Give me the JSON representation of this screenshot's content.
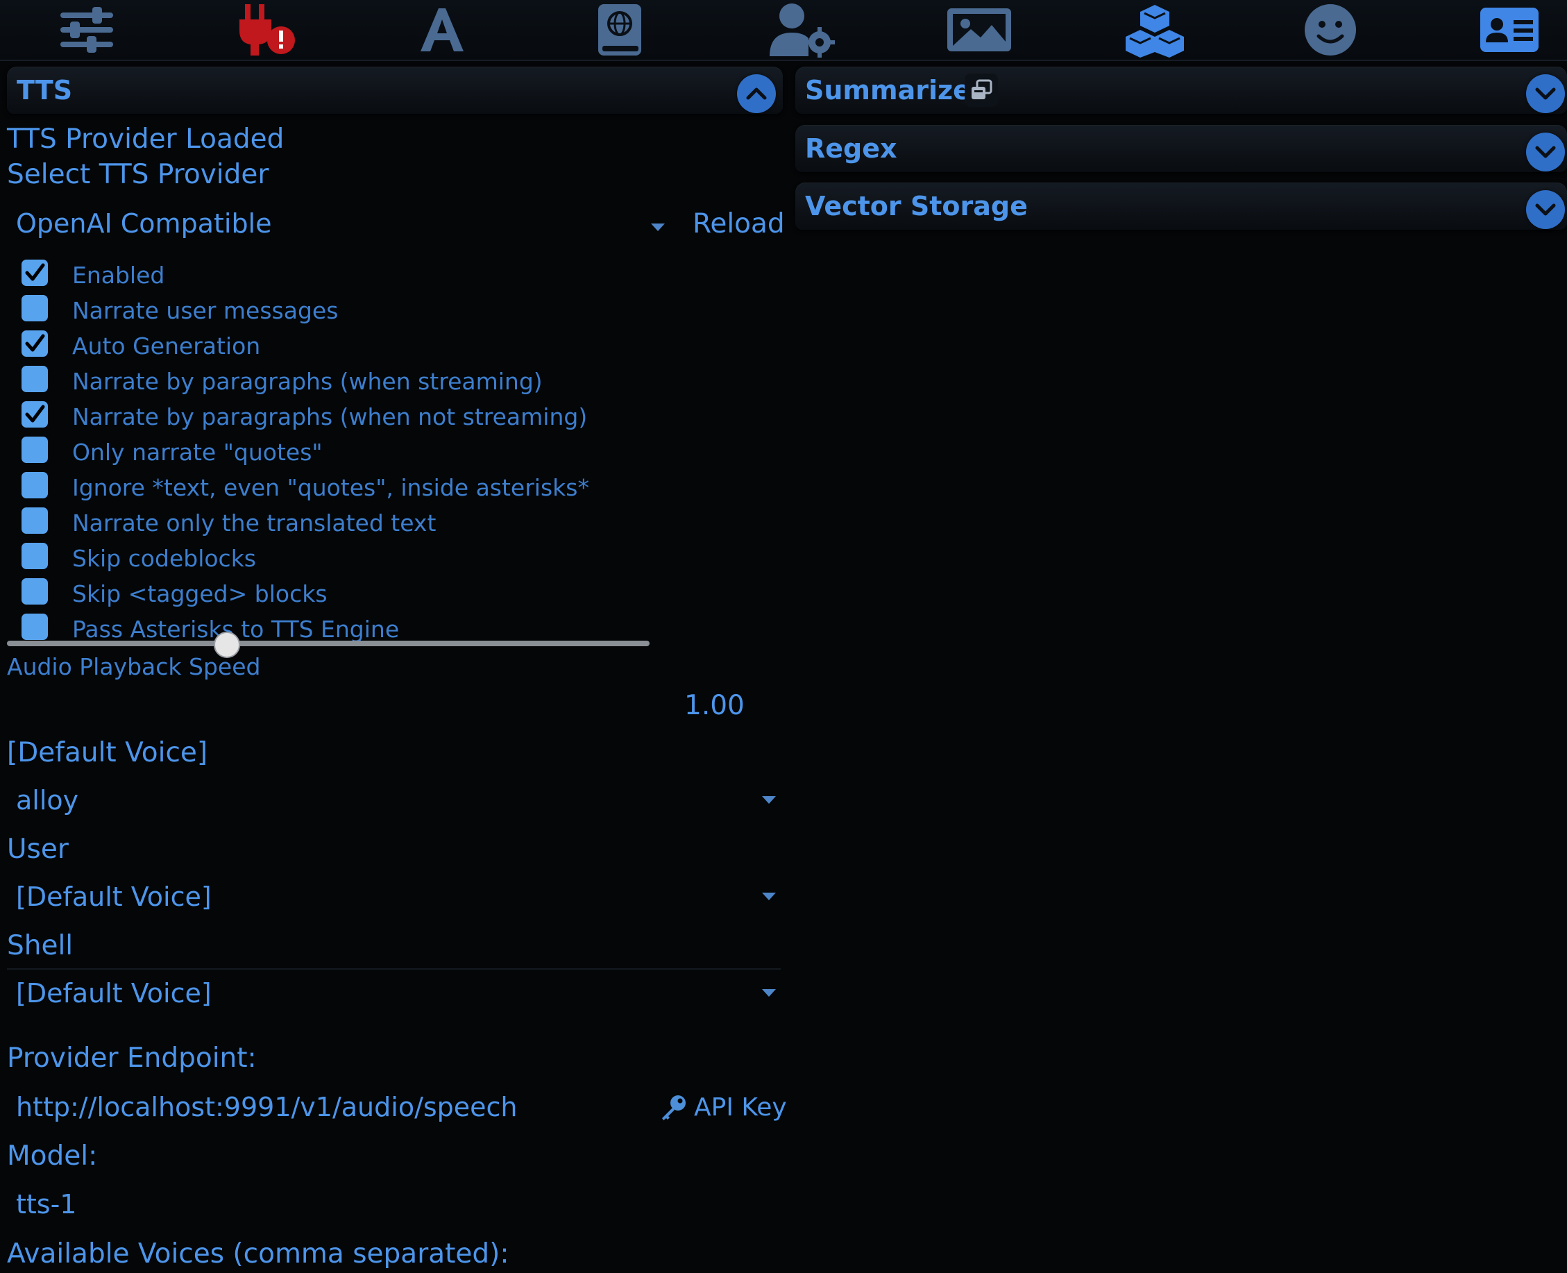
{
  "topbar": {
    "icons": [
      {
        "name": "sliders-icon",
        "color": "#4a6a92"
      },
      {
        "name": "plug-alert-icon",
        "color": "#c0181c"
      },
      {
        "name": "font-icon",
        "color": "#4a6a92"
      },
      {
        "name": "world-book-icon",
        "color": "#4a6a92"
      },
      {
        "name": "user-gear-icon",
        "color": "#4a6a92"
      },
      {
        "name": "image-icon",
        "color": "#4a6a92"
      },
      {
        "name": "cubes-icon",
        "color": "#3f86e6"
      },
      {
        "name": "smile-icon",
        "color": "#4a6a92"
      },
      {
        "name": "id-card-icon",
        "color": "#3f86e6"
      }
    ]
  },
  "tts": {
    "title": "TTS",
    "status": "TTS Provider Loaded",
    "select_label": "Select TTS Provider",
    "provider": "OpenAI Compatible",
    "reload_label": "Reload",
    "options": [
      {
        "label": "Enabled",
        "checked": true
      },
      {
        "label": "Narrate user messages",
        "checked": false
      },
      {
        "label": "Auto Generation",
        "checked": true
      },
      {
        "label": "Narrate by paragraphs (when streaming)",
        "checked": false
      },
      {
        "label": "Narrate by paragraphs (when not streaming)",
        "checked": true
      },
      {
        "label": "Only narrate \"quotes\"",
        "checked": false
      },
      {
        "label": "Ignore *text, even \"quotes\", inside asterisks*",
        "checked": false
      },
      {
        "label": "Narrate only the translated text",
        "checked": false
      },
      {
        "label": "Skip codeblocks",
        "checked": false
      },
      {
        "label": "Skip <tagged> blocks",
        "checked": false
      },
      {
        "label": "Pass Asterisks to TTS Engine",
        "checked": false
      }
    ],
    "speed_label": "Audio Playback Speed",
    "speed_value": "1.00",
    "speed_fraction": 0.34,
    "voices": [
      {
        "label": "[Default Voice]",
        "value": "alloy"
      },
      {
        "label": "User",
        "value": "[Default Voice]"
      },
      {
        "label": "Shell",
        "value": "[Default Voice]"
      }
    ],
    "endpoint_label": "Provider Endpoint:",
    "endpoint_value": "http://localhost:9991/v1/audio/speech",
    "api_key_label": "API Key",
    "model_label": "Model:",
    "model_value": "tts-1",
    "voices_label": "Available Voices (comma separated):"
  },
  "right": {
    "summarize": "Summarize",
    "regex": "Regex",
    "vector": "Vector Storage"
  },
  "colors": {
    "accent": "#4d95ea",
    "checkbox": "#58a3ee",
    "alert": "#c0181c",
    "background": "#040608"
  }
}
